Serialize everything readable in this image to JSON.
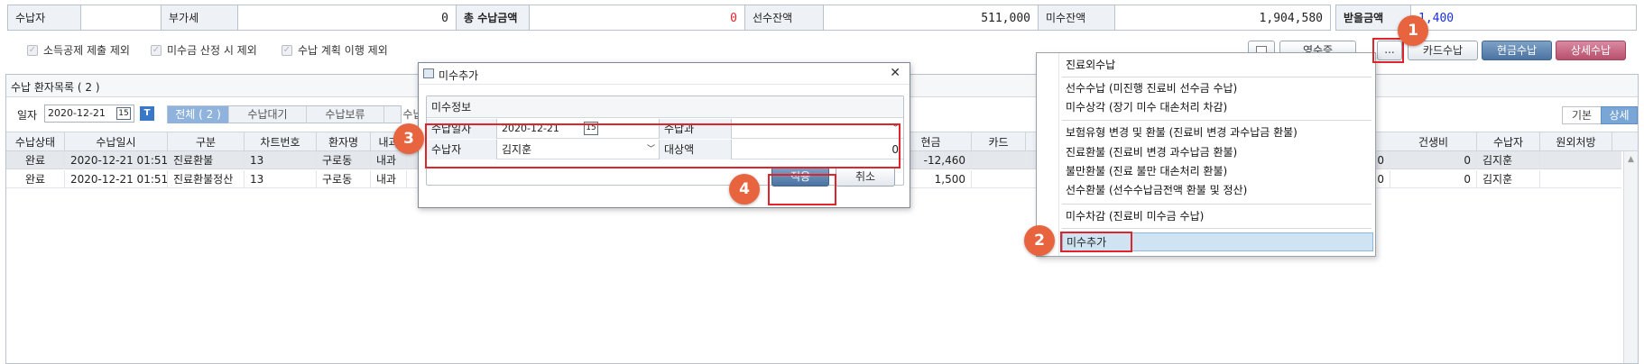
{
  "summary": {
    "payer_label": "수납자",
    "payer_value": "",
    "vat_label": "부가세",
    "vat_value": "0",
    "total_label": "총 수납금액",
    "total_value": "0",
    "advance_label": "선수잔액",
    "advance_value": "511,000",
    "unpaid_label": "미수잔액",
    "unpaid_value": "1,904,580",
    "receivable_label": "받을금액",
    "receivable_value": "1,400"
  },
  "options": {
    "income_deduction": "소득공제 제출 제외",
    "exclude_unpaid_calc": "미수금 산정 시 제외",
    "exclude_payment_plan": "수납 계획 이행 제외"
  },
  "actions": {
    "receipt_button": "영수증",
    "more_button": "...",
    "card_button": "카드수납",
    "cash_button": "현금수납",
    "detail_button": "상세수납"
  },
  "list": {
    "title": "수납 환자목록 ( 2 )",
    "date_label": "일자",
    "date_value": "2020-12-21",
    "calendar_icon_text": "15",
    "t_button": "T",
    "tabs": [
      "전체 ( 2 )",
      "수납대기",
      "수납보류",
      "수납완료"
    ],
    "view_basic": "기본",
    "view_detail": "상세",
    "columns": [
      "수납상태",
      "수납일시",
      "구분",
      "차트번호",
      "환자명",
      "내과",
      "",
      "",
      "",
      "",
      "",
      "",
      "현금",
      "카드",
      "",
      "",
      "",
      "",
      "",
      "건생비",
      "수납자",
      "원외처방"
    ],
    "rows": [
      {
        "status": "완료",
        "datetime": "2020-12-21 01:51",
        "type": "진료환불",
        "chart": "13",
        "name": "구로동",
        "dept": "내과",
        "cash": "-12,460",
        "c1": "0",
        "c2": "0",
        "payer": "김지훈"
      },
      {
        "status": "완료",
        "datetime": "2020-12-21 01:51",
        "type": "진료환불정산",
        "chart": "13",
        "name": "구로동",
        "dept": "내과",
        "cash": "1,500",
        "c1": "0",
        "c2": "0",
        "payer": "김지훈"
      }
    ]
  },
  "dialog": {
    "title": "미수추가",
    "close": "✕",
    "section": "미수정보",
    "date_label": "수납일자",
    "date_value": "2020-12-21",
    "calendar_icon_text": "15",
    "dept_label": "수납과",
    "dept_value": "",
    "payer_label": "수납자",
    "payer_value": "김지훈",
    "amount_label": "대상액",
    "amount_value": "0",
    "apply": "적용",
    "cancel": "취소"
  },
  "menu": {
    "items": [
      "진료외수납",
      "선수수납 (미진행 진료비 선수금 수납)",
      "미수상각 (장기 미수 대손처리 차감)",
      "보험유형 변경 및 환불 (진료비 변경 과수납금 환불)",
      "진료환불 (진료비 변경 과수납금 환불)",
      "불만환불 (진료 불만 대손처리 환불)",
      "선수환불 (선수수납금전액 환불 및 정산)",
      "미수차감 (진료비 미수금 수납)",
      "미수추가"
    ]
  },
  "callouts": [
    "1",
    "2",
    "3",
    "4"
  ],
  "colors": {
    "accent_red": "#e0242c",
    "callout": "#e8643f",
    "blue_value": "#1a2fd6",
    "highlight": "#cfe3f3"
  }
}
